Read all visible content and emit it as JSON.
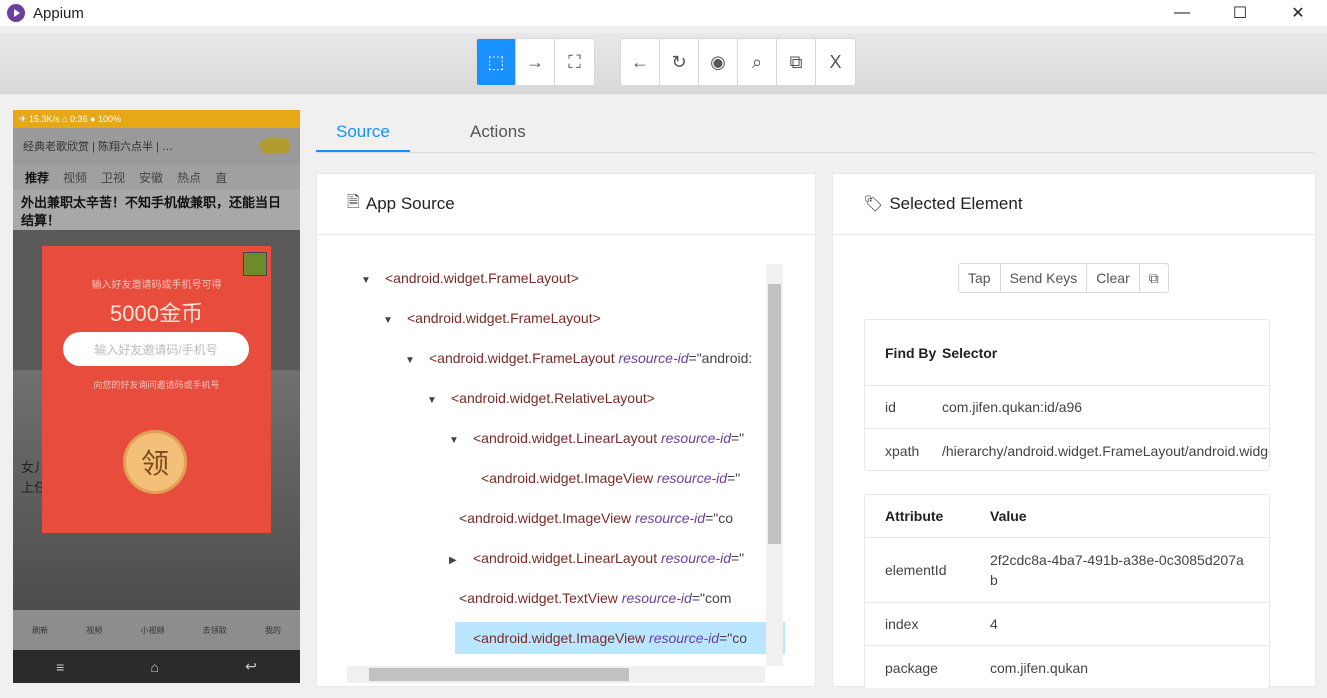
{
  "window": {
    "title": "Appium",
    "minimize": "—",
    "maximize": "☐",
    "close": "✕"
  },
  "toolbar": {
    "group1": [
      {
        "icon": "select-element-icon",
        "glyph": "⬚",
        "active": true
      },
      {
        "icon": "swipe-arrow-icon",
        "glyph": "→",
        "active": false
      },
      {
        "icon": "tap-coordinates-icon",
        "glyph": "⛶",
        "active": false
      }
    ],
    "group2": [
      {
        "icon": "back-icon",
        "glyph": "←"
      },
      {
        "icon": "refresh-icon",
        "glyph": "↻"
      },
      {
        "icon": "eye-icon",
        "glyph": "◉"
      },
      {
        "icon": "search-icon",
        "glyph": "⌕"
      },
      {
        "icon": "copy-icon",
        "glyph": "⧉"
      },
      {
        "icon": "close-icon",
        "glyph": "X"
      }
    ]
  },
  "device": {
    "status": "✈ 15.3K/s ⌂ 0:36 ● 100%",
    "search_text": "经典老歌欣赏 | 陈翔六点半 | …",
    "tabs": [
      "推荐",
      "视频",
      "卫视",
      "安徽",
      "热点",
      "直"
    ],
    "headline": "外出兼职太辛苦！不知手机做兼职，还能当日结算！",
    "popup_hint": "输入好友邀请码或手机号可得",
    "popup_gold": "5000金币",
    "popup_input": "输入好友邀请码/手机号",
    "popup_sub": "向您的好友询问邀请码或手机号",
    "popup_coin": "领",
    "left_text": "女儿\n上任",
    "nav": [
      "刷新",
      "视频",
      "小视频",
      "去领取",
      "我的"
    ],
    "sys": [
      "≡",
      "⌂",
      "↩"
    ]
  },
  "tabs": {
    "source": "Source",
    "actions": "Actions"
  },
  "app_source": {
    "title": "App Source",
    "nodes": [
      {
        "caret": "▼",
        "tag": "<android.widget.FrameLayout>",
        "attr": "",
        "val": "",
        "indent": 0
      },
      {
        "caret": "▼",
        "tag": "<android.widget.FrameLayout>",
        "attr": "",
        "val": "",
        "indent": 1
      },
      {
        "caret": "▼",
        "tag": "<android.widget.FrameLayout ",
        "attr": "resource-id",
        "val": "=\"android:",
        "indent": 2
      },
      {
        "caret": "▼",
        "tag": "<android.widget.RelativeLayout>",
        "attr": "",
        "val": "",
        "indent": 3
      },
      {
        "caret": "▼",
        "tag": "<android.widget.LinearLayout ",
        "attr": "resource-id",
        "val": "=\"",
        "indent": 4
      },
      {
        "caret": "",
        "tag": "<android.widget.ImageView ",
        "attr": "resource-id",
        "val": "=\"",
        "indent": 5
      },
      {
        "caret": "",
        "tag": "<android.widget.ImageView ",
        "attr": "resource-id",
        "val": "=\"co",
        "indent": 4
      },
      {
        "caret": "▶",
        "tag": "<android.widget.LinearLayout ",
        "attr": "resource-id",
        "val": "=\"",
        "indent": 4
      },
      {
        "caret": "",
        "tag": "<android.widget.TextView ",
        "attr": "resource-id",
        "val": "=\"com",
        "indent": 4
      },
      {
        "caret": "",
        "tag": "<android.widget.ImageView ",
        "attr": "resource-id",
        "val": "=\"co",
        "indent": 4,
        "selected": true
      }
    ]
  },
  "selected_element": {
    "title": "Selected Element",
    "buttons": [
      "Tap",
      "Send Keys",
      "Clear"
    ],
    "find_by": {
      "headers": [
        "Find By",
        "Selector"
      ],
      "rows": [
        [
          "id",
          "com.jifen.qukan:id/a96"
        ],
        [
          "xpath",
          "/hierarchy/android.widget.FrameLayout/android.widget"
        ]
      ]
    },
    "attributes": {
      "headers": [
        "Attribute",
        "Value"
      ],
      "rows": [
        [
          "elementId",
          "2f2cdc8a-4ba7-491b-a38e-0c3085d207ab"
        ],
        [
          "index",
          "4"
        ],
        [
          "package",
          "com.jifen.qukan"
        ]
      ]
    }
  }
}
